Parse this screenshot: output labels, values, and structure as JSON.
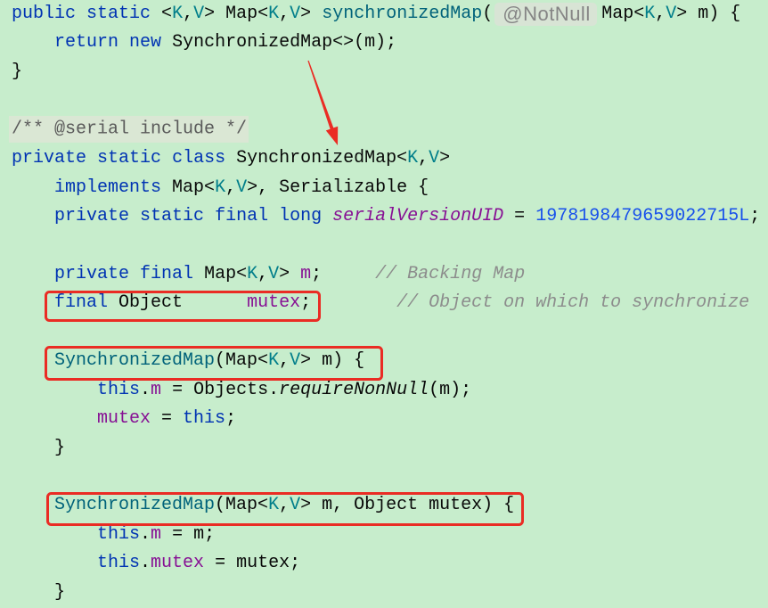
{
  "editor": {
    "background": "#c7edcc",
    "colors": {
      "kw": "#0033b3",
      "tp": "#007e8a",
      "txt": "#080808",
      "decl": "#00627a",
      "field": "#871094",
      "sfield": "#871094",
      "num": "#1750eb",
      "cmt": "#8c8c8c",
      "doc": "#5a5a5a",
      "call": "#080808",
      "inlay": "#858585"
    },
    "lines": [
      [
        {
          "k": "kw",
          "t": "public"
        },
        {
          "k": "txt",
          "t": " "
        },
        {
          "k": "kw",
          "t": "static"
        },
        {
          "k": "txt",
          "t": " <"
        },
        {
          "k": "tp",
          "t": "K"
        },
        {
          "k": "txt",
          "t": ","
        },
        {
          "k": "tp",
          "t": "V"
        },
        {
          "k": "txt",
          "t": "> Map<"
        },
        {
          "k": "tp",
          "t": "K"
        },
        {
          "k": "txt",
          "t": ","
        },
        {
          "k": "tp",
          "t": "V"
        },
        {
          "k": "txt",
          "t": "> "
        },
        {
          "k": "decl",
          "t": "synchronizedMap"
        },
        {
          "k": "txt",
          "t": "("
        },
        {
          "k": "inlay",
          "t": "@NotNull"
        },
        {
          "k": "txt",
          "t": "Map<"
        },
        {
          "k": "tp",
          "t": "K"
        },
        {
          "k": "txt",
          "t": ","
        },
        {
          "k": "tp",
          "t": "V"
        },
        {
          "k": "txt",
          "t": "> m) {"
        }
      ],
      [
        {
          "k": "txt",
          "t": "    "
        },
        {
          "k": "kw",
          "t": "return"
        },
        {
          "k": "txt",
          "t": " "
        },
        {
          "k": "kw",
          "t": "new"
        },
        {
          "k": "txt",
          "t": " SynchronizedMap<>(m);"
        }
      ],
      [
        {
          "k": "txt",
          "t": "}"
        }
      ],
      [],
      [
        {
          "k": "doc",
          "t": "/** @serial include */"
        }
      ],
      [
        {
          "k": "kw",
          "t": "private"
        },
        {
          "k": "txt",
          "t": " "
        },
        {
          "k": "kw",
          "t": "static"
        },
        {
          "k": "txt",
          "t": " "
        },
        {
          "k": "kw",
          "t": "class"
        },
        {
          "k": "txt",
          "t": " SynchronizedMap<"
        },
        {
          "k": "tp",
          "t": "K"
        },
        {
          "k": "txt",
          "t": ","
        },
        {
          "k": "tp",
          "t": "V"
        },
        {
          "k": "txt",
          "t": ">"
        }
      ],
      [
        {
          "k": "txt",
          "t": "    "
        },
        {
          "k": "kw",
          "t": "implements"
        },
        {
          "k": "txt",
          "t": " Map<"
        },
        {
          "k": "tp",
          "t": "K"
        },
        {
          "k": "txt",
          "t": ","
        },
        {
          "k": "tp",
          "t": "V"
        },
        {
          "k": "txt",
          "t": ">, Serializable {"
        }
      ],
      [
        {
          "k": "txt",
          "t": "    "
        },
        {
          "k": "kw",
          "t": "private"
        },
        {
          "k": "txt",
          "t": " "
        },
        {
          "k": "kw",
          "t": "static"
        },
        {
          "k": "txt",
          "t": " "
        },
        {
          "k": "kw",
          "t": "final"
        },
        {
          "k": "txt",
          "t": " "
        },
        {
          "k": "kw",
          "t": "long"
        },
        {
          "k": "txt",
          "t": " "
        },
        {
          "k": "sfield",
          "t": "serialVersionUID"
        },
        {
          "k": "txt",
          "t": " = "
        },
        {
          "k": "num",
          "t": "1978198479659022715L"
        },
        {
          "k": "txt",
          "t": ";"
        }
      ],
      [],
      [
        {
          "k": "txt",
          "t": "    "
        },
        {
          "k": "kw",
          "t": "private"
        },
        {
          "k": "txt",
          "t": " "
        },
        {
          "k": "kw",
          "t": "final"
        },
        {
          "k": "txt",
          "t": " Map<"
        },
        {
          "k": "tp",
          "t": "K"
        },
        {
          "k": "txt",
          "t": ","
        },
        {
          "k": "tp",
          "t": "V"
        },
        {
          "k": "txt",
          "t": "> "
        },
        {
          "k": "field",
          "t": "m"
        },
        {
          "k": "txt",
          "t": ";     "
        },
        {
          "k": "cmt",
          "t": "// Backing Map"
        }
      ],
      [
        {
          "k": "txt",
          "t": "    "
        },
        {
          "k": "kw",
          "t": "final"
        },
        {
          "k": "txt",
          "t": " Object      "
        },
        {
          "k": "field",
          "t": "mutex"
        },
        {
          "k": "txt",
          "t": ";        "
        },
        {
          "k": "cmt",
          "t": "// Object on which to synchronize"
        }
      ],
      [],
      [
        {
          "k": "txt",
          "t": "    "
        },
        {
          "k": "decl",
          "t": "SynchronizedMap"
        },
        {
          "k": "txt",
          "t": "(Map<"
        },
        {
          "k": "tp",
          "t": "K"
        },
        {
          "k": "txt",
          "t": ","
        },
        {
          "k": "tp",
          "t": "V"
        },
        {
          "k": "txt",
          "t": "> m) {"
        }
      ],
      [
        {
          "k": "txt",
          "t": "        "
        },
        {
          "k": "kw",
          "t": "this"
        },
        {
          "k": "txt",
          "t": "."
        },
        {
          "k": "field",
          "t": "m"
        },
        {
          "k": "txt",
          "t": " = Objects."
        },
        {
          "k": "call",
          "t": "requireNonNull"
        },
        {
          "k": "txt",
          "t": "(m);"
        }
      ],
      [
        {
          "k": "txt",
          "t": "        "
        },
        {
          "k": "field",
          "t": "mutex"
        },
        {
          "k": "txt",
          "t": " = "
        },
        {
          "k": "kw",
          "t": "this"
        },
        {
          "k": "txt",
          "t": ";"
        }
      ],
      [
        {
          "k": "txt",
          "t": "    }"
        }
      ],
      [],
      [
        {
          "k": "txt",
          "t": "    "
        },
        {
          "k": "decl",
          "t": "SynchronizedMap"
        },
        {
          "k": "txt",
          "t": "(Map<"
        },
        {
          "k": "tp",
          "t": "K"
        },
        {
          "k": "txt",
          "t": ","
        },
        {
          "k": "tp",
          "t": "V"
        },
        {
          "k": "txt",
          "t": "> m, Object mutex) {"
        }
      ],
      [
        {
          "k": "txt",
          "t": "        "
        },
        {
          "k": "kw",
          "t": "this"
        },
        {
          "k": "txt",
          "t": "."
        },
        {
          "k": "field",
          "t": "m"
        },
        {
          "k": "txt",
          "t": " = m;"
        }
      ],
      [
        {
          "k": "txt",
          "t": "        "
        },
        {
          "k": "kw",
          "t": "this"
        },
        {
          "k": "txt",
          "t": "."
        },
        {
          "k": "field",
          "t": "mutex"
        },
        {
          "k": "txt",
          "t": " = mutex;"
        }
      ],
      [
        {
          "k": "txt",
          "t": "    }"
        }
      ]
    ]
  },
  "annotations": {
    "color": "#ea2c24"
  }
}
